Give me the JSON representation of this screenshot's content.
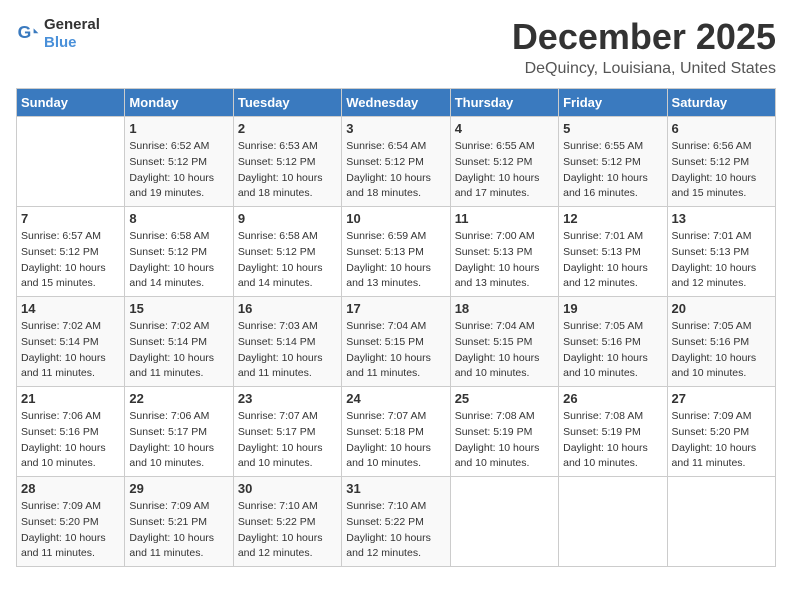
{
  "logo": {
    "general": "General",
    "blue": "Blue"
  },
  "title": "December 2025",
  "location": "DeQuincy, Louisiana, United States",
  "headers": [
    "Sunday",
    "Monday",
    "Tuesday",
    "Wednesday",
    "Thursday",
    "Friday",
    "Saturday"
  ],
  "weeks": [
    [
      {
        "day": "",
        "info": ""
      },
      {
        "day": "1",
        "info": "Sunrise: 6:52 AM\nSunset: 5:12 PM\nDaylight: 10 hours\nand 19 minutes."
      },
      {
        "day": "2",
        "info": "Sunrise: 6:53 AM\nSunset: 5:12 PM\nDaylight: 10 hours\nand 18 minutes."
      },
      {
        "day": "3",
        "info": "Sunrise: 6:54 AM\nSunset: 5:12 PM\nDaylight: 10 hours\nand 18 minutes."
      },
      {
        "day": "4",
        "info": "Sunrise: 6:55 AM\nSunset: 5:12 PM\nDaylight: 10 hours\nand 17 minutes."
      },
      {
        "day": "5",
        "info": "Sunrise: 6:55 AM\nSunset: 5:12 PM\nDaylight: 10 hours\nand 16 minutes."
      },
      {
        "day": "6",
        "info": "Sunrise: 6:56 AM\nSunset: 5:12 PM\nDaylight: 10 hours\nand 15 minutes."
      }
    ],
    [
      {
        "day": "7",
        "info": "Sunrise: 6:57 AM\nSunset: 5:12 PM\nDaylight: 10 hours\nand 15 minutes."
      },
      {
        "day": "8",
        "info": "Sunrise: 6:58 AM\nSunset: 5:12 PM\nDaylight: 10 hours\nand 14 minutes."
      },
      {
        "day": "9",
        "info": "Sunrise: 6:58 AM\nSunset: 5:12 PM\nDaylight: 10 hours\nand 14 minutes."
      },
      {
        "day": "10",
        "info": "Sunrise: 6:59 AM\nSunset: 5:13 PM\nDaylight: 10 hours\nand 13 minutes."
      },
      {
        "day": "11",
        "info": "Sunrise: 7:00 AM\nSunset: 5:13 PM\nDaylight: 10 hours\nand 13 minutes."
      },
      {
        "day": "12",
        "info": "Sunrise: 7:01 AM\nSunset: 5:13 PM\nDaylight: 10 hours\nand 12 minutes."
      },
      {
        "day": "13",
        "info": "Sunrise: 7:01 AM\nSunset: 5:13 PM\nDaylight: 10 hours\nand 12 minutes."
      }
    ],
    [
      {
        "day": "14",
        "info": "Sunrise: 7:02 AM\nSunset: 5:14 PM\nDaylight: 10 hours\nand 11 minutes."
      },
      {
        "day": "15",
        "info": "Sunrise: 7:02 AM\nSunset: 5:14 PM\nDaylight: 10 hours\nand 11 minutes."
      },
      {
        "day": "16",
        "info": "Sunrise: 7:03 AM\nSunset: 5:14 PM\nDaylight: 10 hours\nand 11 minutes."
      },
      {
        "day": "17",
        "info": "Sunrise: 7:04 AM\nSunset: 5:15 PM\nDaylight: 10 hours\nand 11 minutes."
      },
      {
        "day": "18",
        "info": "Sunrise: 7:04 AM\nSunset: 5:15 PM\nDaylight: 10 hours\nand 10 minutes."
      },
      {
        "day": "19",
        "info": "Sunrise: 7:05 AM\nSunset: 5:16 PM\nDaylight: 10 hours\nand 10 minutes."
      },
      {
        "day": "20",
        "info": "Sunrise: 7:05 AM\nSunset: 5:16 PM\nDaylight: 10 hours\nand 10 minutes."
      }
    ],
    [
      {
        "day": "21",
        "info": "Sunrise: 7:06 AM\nSunset: 5:16 PM\nDaylight: 10 hours\nand 10 minutes."
      },
      {
        "day": "22",
        "info": "Sunrise: 7:06 AM\nSunset: 5:17 PM\nDaylight: 10 hours\nand 10 minutes."
      },
      {
        "day": "23",
        "info": "Sunrise: 7:07 AM\nSunset: 5:17 PM\nDaylight: 10 hours\nand 10 minutes."
      },
      {
        "day": "24",
        "info": "Sunrise: 7:07 AM\nSunset: 5:18 PM\nDaylight: 10 hours\nand 10 minutes."
      },
      {
        "day": "25",
        "info": "Sunrise: 7:08 AM\nSunset: 5:19 PM\nDaylight: 10 hours\nand 10 minutes."
      },
      {
        "day": "26",
        "info": "Sunrise: 7:08 AM\nSunset: 5:19 PM\nDaylight: 10 hours\nand 10 minutes."
      },
      {
        "day": "27",
        "info": "Sunrise: 7:09 AM\nSunset: 5:20 PM\nDaylight: 10 hours\nand 11 minutes."
      }
    ],
    [
      {
        "day": "28",
        "info": "Sunrise: 7:09 AM\nSunset: 5:20 PM\nDaylight: 10 hours\nand 11 minutes."
      },
      {
        "day": "29",
        "info": "Sunrise: 7:09 AM\nSunset: 5:21 PM\nDaylight: 10 hours\nand 11 minutes."
      },
      {
        "day": "30",
        "info": "Sunrise: 7:10 AM\nSunset: 5:22 PM\nDaylight: 10 hours\nand 12 minutes."
      },
      {
        "day": "31",
        "info": "Sunrise: 7:10 AM\nSunset: 5:22 PM\nDaylight: 10 hours\nand 12 minutes."
      },
      {
        "day": "",
        "info": ""
      },
      {
        "day": "",
        "info": ""
      },
      {
        "day": "",
        "info": ""
      }
    ]
  ]
}
